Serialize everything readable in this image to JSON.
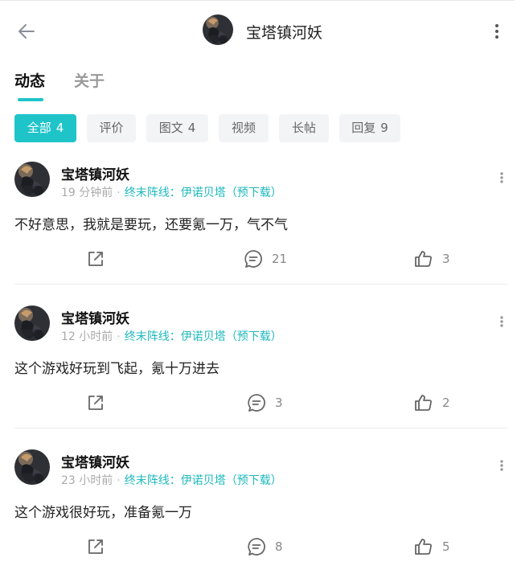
{
  "header": {
    "title": "宝塔镇河妖",
    "back_icon": "arrow-left-icon",
    "more_icon": "more-vertical-icon"
  },
  "tabs": [
    {
      "label": "动态",
      "active": true
    },
    {
      "label": "关于",
      "active": false
    }
  ],
  "filters": [
    {
      "label": "全部",
      "count": "4",
      "active": true
    },
    {
      "label": "评价",
      "count": ""
    },
    {
      "label": "图文",
      "count": "4"
    },
    {
      "label": "视频",
      "count": ""
    },
    {
      "label": "长帖",
      "count": ""
    },
    {
      "label": "回复",
      "count": "9"
    }
  ],
  "posts": [
    {
      "author": "宝塔镇河妖",
      "time": "19 分钟前",
      "separator": "·",
      "game": "终末阵线：伊诺贝塔（预下载）",
      "content": "不好意思，我就是要玩，还要氪一万，气不气",
      "comments": "21",
      "likes": "3"
    },
    {
      "author": "宝塔镇河妖",
      "time": "12 小时前",
      "separator": "·",
      "game": "终末阵线：伊诺贝塔（预下载）",
      "content": "这个游戏好玩到飞起，氪十万进去",
      "comments": "3",
      "likes": "2"
    },
    {
      "author": "宝塔镇河妖",
      "time": "23 小时前",
      "separator": "·",
      "game": "终末阵线：伊诺贝塔（预下载）",
      "content": "这个游戏很好玩，准备氪一万",
      "comments": "8",
      "likes": "5"
    }
  ],
  "colors": {
    "accent": "#1fc4c9",
    "link": "#1fb8bd",
    "chip_bg": "#f3f4f6",
    "muted": "#aaaaaa"
  },
  "icons": [
    "arrow-left-icon",
    "more-vertical-icon",
    "share-icon",
    "comment-icon",
    "thumbs-up-icon"
  ]
}
